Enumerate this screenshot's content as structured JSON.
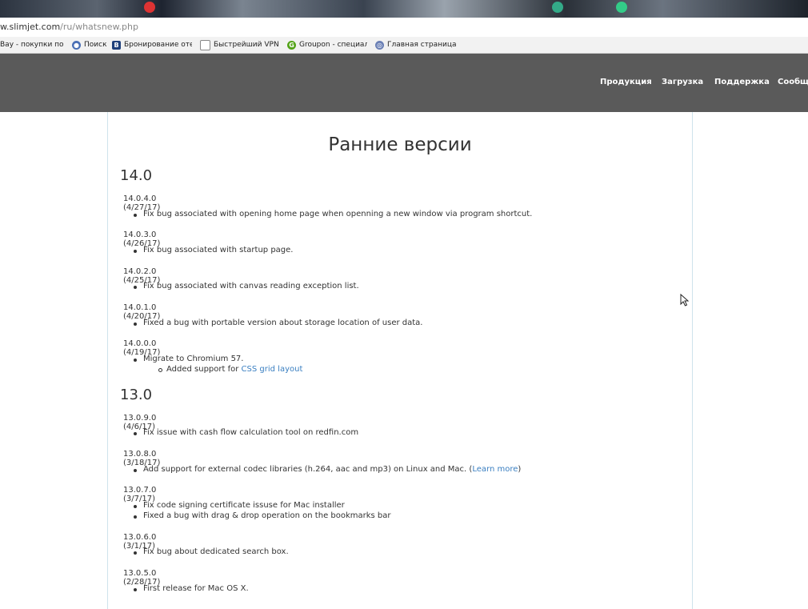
{
  "browser": {
    "address_host": "w.slimjet.com",
    "address_path": "/ru/whatsnew.php",
    "bookmarks": [
      {
        "icon": "ebay-icon",
        "label": "Bay - покупки по ск"
      },
      {
        "icon": "search-icon",
        "label": "Поиск"
      },
      {
        "icon": "booking-icon",
        "label": "Бронирование отелє"
      },
      {
        "icon": "page-icon",
        "label": "Быстрейший VPN в м"
      },
      {
        "icon": "groupon-icon",
        "label": "Groupon - специальн"
      },
      {
        "icon": "globe-icon",
        "label": "Главная страница Sli"
      }
    ]
  },
  "nav": {
    "items": [
      "Продукция",
      "Загрузка",
      "Поддержка",
      "Сообщ"
    ],
    "background": "#5a5a5a"
  },
  "page": {
    "title": "Ранние версии",
    "link_color": "#3a7fc1"
  },
  "releases": {
    "v14": {
      "major": "14.0",
      "r1": {
        "version": "14.0.4.0 (4/27/17)",
        "notes": [
          "Fix bug associated with opening home page when openning a new window via program shortcut."
        ]
      },
      "r2": {
        "version": "14.0.3.0 (4/26/17)",
        "notes": [
          "Fix bug associated with startup page."
        ]
      },
      "r3": {
        "version": "14.0.2.0 (4/25/17)",
        "notes": [
          "Fix bug associated with canvas reading exception list."
        ]
      },
      "r4": {
        "version": "14.0.1.0 (4/20/17)",
        "notes": [
          "Fixed a bug with portable version about storage location of user data."
        ]
      },
      "r5": {
        "version": "14.0.0.0 (4/19/17)",
        "notes": [
          "Migrate to Chromium 57."
        ],
        "sub_prefix": "Added support for ",
        "sub_link": "CSS grid layout"
      }
    },
    "v13": {
      "major": "13.0",
      "r1": {
        "version": "13.0.9.0 (4/6/17)",
        "notes": [
          "Fix issue with cash flow calculation tool on redfin.com"
        ]
      },
      "r2": {
        "version": "13.0.8.0 (3/18/17)",
        "note_prefix": "Add support for external codec libraries (h.264, aac and mp3) on Linux and Mac. (",
        "note_link": "Learn more",
        "note_suffix": ")"
      },
      "r3": {
        "version": "13.0.7.0 (3/7/17)",
        "notes": [
          "Fix code signing certificate issuse for Mac installer",
          "Fixed a bug with drag & drop operation on the bookmarks bar"
        ]
      },
      "r4": {
        "version": "13.0.6.0 (3/1/17)",
        "notes": [
          "Fix bug about dedicated search box."
        ]
      },
      "r5": {
        "version": "13.0.5.0 (2/28/17)",
        "notes": [
          "First release for Mac OS X."
        ]
      }
    }
  }
}
